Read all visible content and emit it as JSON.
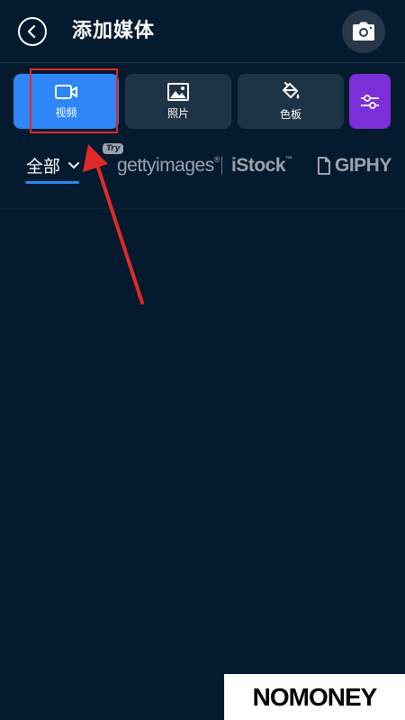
{
  "header": {
    "title": "添加媒体",
    "back_icon": "back-chevron-icon",
    "camera_icon": "camera-icon"
  },
  "tiles": [
    {
      "label": "视频",
      "icon": "video-icon",
      "active": true
    },
    {
      "label": "照片",
      "icon": "image-icon",
      "active": false
    },
    {
      "label": "色板",
      "icon": "paint-bucket-icon",
      "active": false
    },
    {
      "label": "",
      "icon": "sliders-icon",
      "active": false
    }
  ],
  "filters": {
    "all_label": "全部",
    "try_badge": "Try",
    "sources": [
      "gettyimages",
      "iStock",
      "GIPHY"
    ],
    "istock_tm": "™",
    "getty_reg": "®"
  },
  "watermark": {
    "text": "NOMONEY"
  },
  "colors": {
    "background": "#041a2e",
    "accent": "#2f86f7",
    "tile": "#1f3346",
    "purple": "#7b2fd8",
    "annotation": "#e02a2a"
  }
}
